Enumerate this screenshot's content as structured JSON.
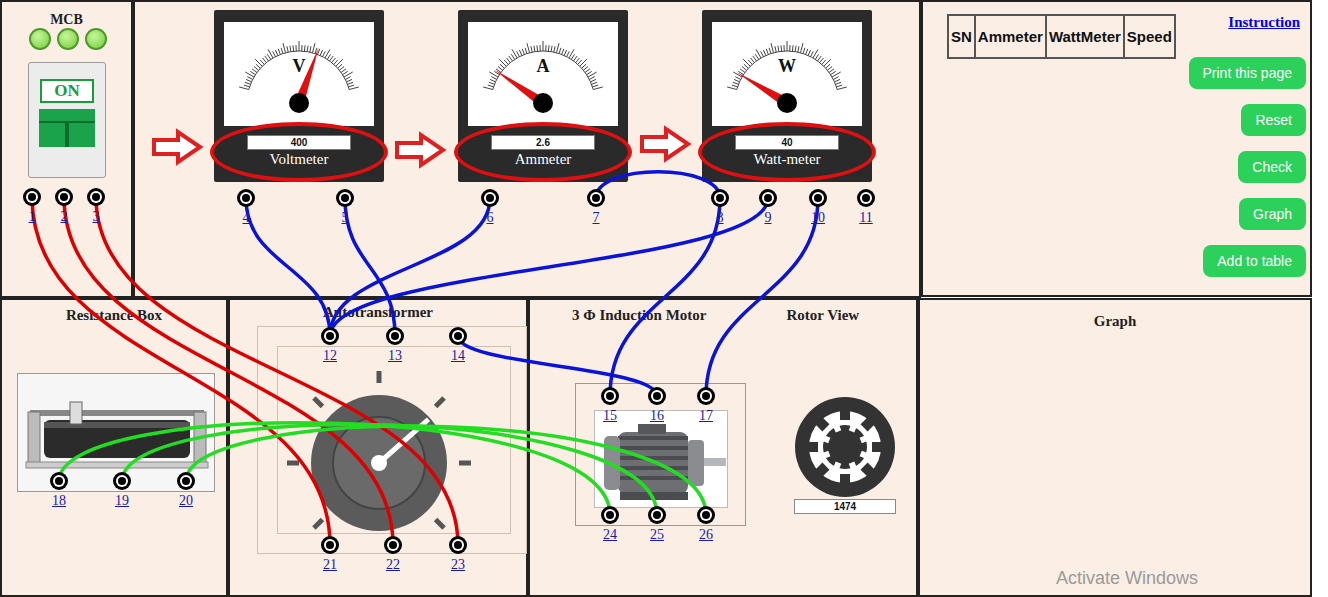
{
  "mcb": {
    "title": "MCB",
    "lights": [
      {
        "on": true
      },
      {
        "on": true
      },
      {
        "on": true
      }
    ],
    "switch": {
      "label": "ON",
      "on": true
    }
  },
  "meters": [
    {
      "symbol": "V",
      "label": "Voltmeter",
      "reading": "400",
      "level": 0.63
    },
    {
      "symbol": "A",
      "label": "Ammeter",
      "reading": "2.6",
      "level": 0.13
    },
    {
      "symbol": "W",
      "label": "Watt-meter",
      "reading": "40",
      "level": 0.11
    }
  ],
  "panels": {
    "resistance_box": "Resistance Box",
    "autotransformer": "Autotransformer",
    "motor": "3 Φ Induction Motor",
    "rotor_view": "Rotor View",
    "graph": "Graph"
  },
  "autotransformer": {
    "level": 0.68
  },
  "rotor": {
    "speed": "1474"
  },
  "table": {
    "columns": [
      "SN",
      "Ammeter",
      "WattMeter",
      "Speed"
    ]
  },
  "instruction_link": "Instruction",
  "buttons": [
    "Print this page",
    "Reset",
    "Check",
    "Graph",
    "Add to table"
  ],
  "terminals": [
    "1",
    "2",
    "3",
    "4",
    "5",
    "6",
    "7",
    "8",
    "9",
    "10",
    "11",
    "12",
    "13",
    "14",
    "15",
    "16",
    "17",
    "18",
    "19",
    "20",
    "21",
    "22",
    "23",
    "24",
    "25",
    "26"
  ],
  "wires": [
    {
      "from": "1",
      "to": "21",
      "color": "#dd0000"
    },
    {
      "from": "2",
      "to": "22",
      "color": "#dd0000"
    },
    {
      "from": "3",
      "to": "23",
      "color": "#dd0000"
    },
    {
      "from": "4",
      "to": "12",
      "color": "#0a14d8"
    },
    {
      "from": "5",
      "to": "13",
      "color": "#0a14d8"
    },
    {
      "from": "6",
      "to": "12",
      "color": "#0a14d8"
    },
    {
      "from": "7",
      "to": "8",
      "color": "#0a14d8"
    },
    {
      "from": "9",
      "to": "12",
      "color": "#0a14d8"
    },
    {
      "from": "8",
      "to": "15",
      "color": "#0a14d8"
    },
    {
      "from": "10",
      "to": "17",
      "color": "#0a14d8"
    },
    {
      "from": "14",
      "to": "16",
      "color": "#0a14d8"
    },
    {
      "from": "18",
      "to": "24",
      "color": "#22dd22"
    },
    {
      "from": "19",
      "to": "25",
      "color": "#22dd22"
    },
    {
      "from": "20",
      "to": "26",
      "color": "#22dd22"
    }
  ],
  "watermark": "Activate Windows"
}
